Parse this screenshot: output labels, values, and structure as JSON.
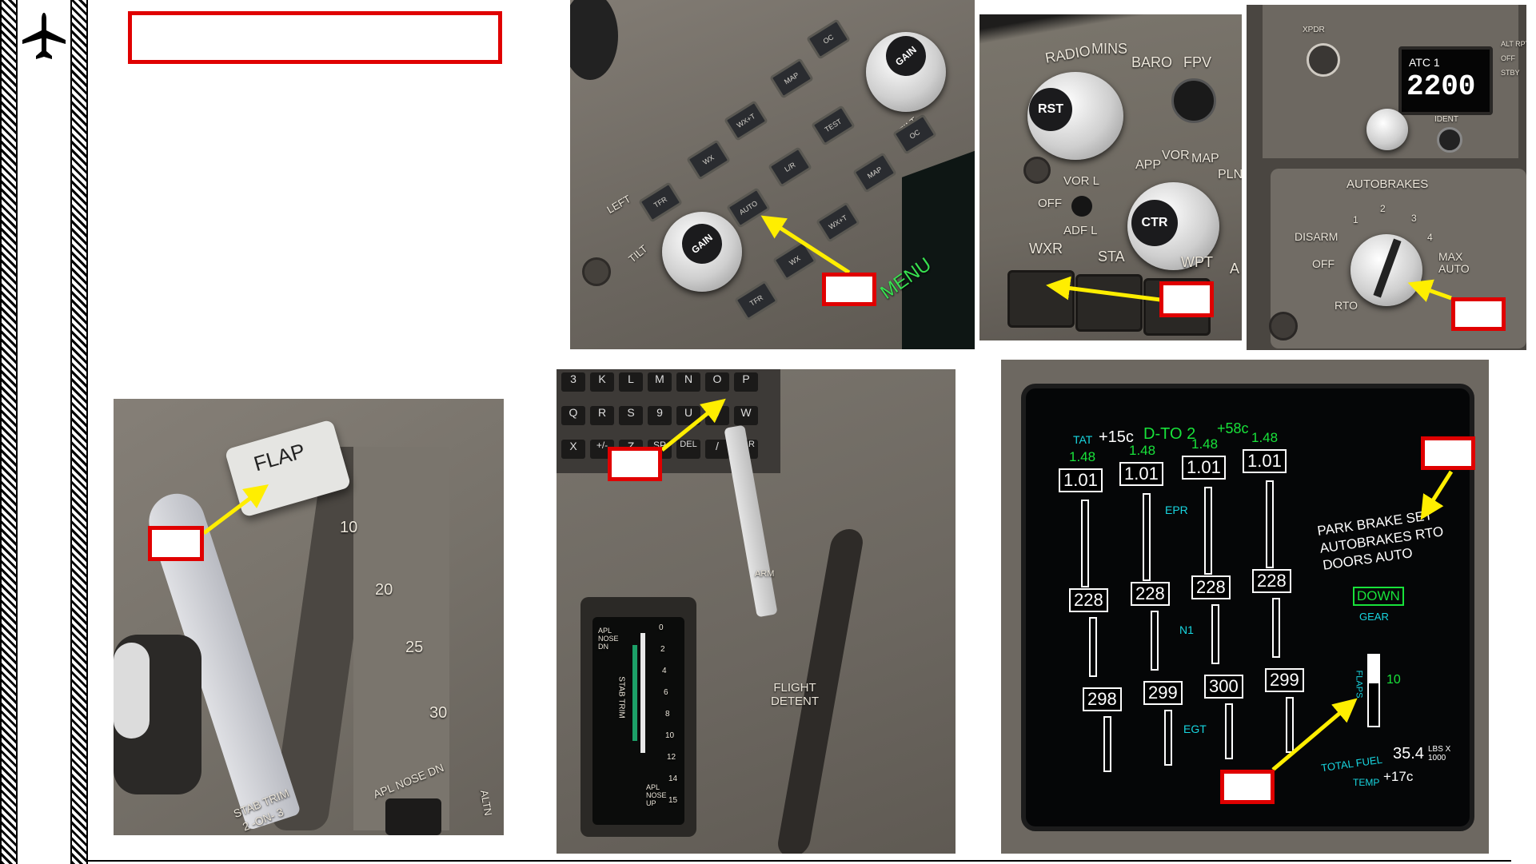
{
  "sidebar": {
    "icon": "airplane-icon"
  },
  "title_box": {
    "text": ""
  },
  "callouts": {
    "mode_button": "",
    "wxr_button": "",
    "autobrake_knob": "",
    "flap_lever": "",
    "speedbrake_lever": "",
    "eicas_status": "",
    "flaps_indicator": ""
  },
  "weather_radar": {
    "gain_label": "GAIN",
    "tilt_label": "TILT",
    "left_label": "LEFT",
    "buttons": [
      "TFR",
      "WX",
      "WX+T",
      "MAP",
      "OC",
      "AUTO",
      "L/R",
      "TEST",
      "MAP",
      "OC",
      "TFR",
      "WX",
      "WX+T",
      "GAIN"
    ],
    "menu_label": "MENU"
  },
  "efis": {
    "radio": "RADIO",
    "mins": "MINS",
    "baro": "BARO",
    "fpv": "FPV",
    "rst": "RST",
    "ctr": "CTR",
    "vor_l": "VOR L",
    "off": "OFF",
    "adf_l": "ADF L",
    "app": "APP",
    "vor": "VOR",
    "map": "MAP",
    "pln": "PLN",
    "wxr": "WXR",
    "sta": "STA",
    "wpt": "WPT",
    "arpt": "A"
  },
  "autobrakes": {
    "xpdr": "XPDR",
    "atc_label": "ATC 1",
    "atc_code": "2200",
    "ident": "IDENT",
    "title": "AUTOBRAKES",
    "positions": [
      "DISARM",
      "OFF",
      "RTO",
      "1",
      "2",
      "3",
      "4",
      "MAX AUTO"
    ],
    "side": [
      "ALT RPTG",
      "OFF",
      "STBY"
    ]
  },
  "flap_panel": {
    "handle_label": "FLAP",
    "detents": [
      "10",
      "20",
      "25",
      "30"
    ],
    "stab_trim": "STAB TRIM",
    "stab_trim_sub": "2 -ON- 3",
    "apl_nose_dn": "APL NOSE DN",
    "altn": "ALTN"
  },
  "speedbrake_panel": {
    "keys": [
      "3",
      "K",
      "L",
      "M",
      "N",
      "O",
      "P",
      "Q",
      "R",
      "S",
      "9",
      "U",
      "V",
      "W",
      "X",
      "+/-",
      "Z",
      "SP",
      "DEL",
      "/",
      "CLR"
    ],
    "arm": "ARM",
    "flight_detent": "FLIGHT DETENT",
    "stab_trim": "STAB TRIM",
    "apl_nose_dn": "APL NOSE DN",
    "apl_nose_up": "APL NOSE UP",
    "scale": [
      "0",
      "2",
      "4",
      "6",
      "8",
      "10",
      "12",
      "14",
      "15"
    ]
  },
  "eicas": {
    "tat": "TAT",
    "tat_val": "+15c",
    "mode": "D-TO 2",
    "tat2": "+58c",
    "epr_ref": [
      "1.48",
      "1.48",
      "1.48",
      "1.48"
    ],
    "epr": [
      "1.01",
      "1.01",
      "1.01",
      "1.01"
    ],
    "epr_label": "EPR",
    "n1": [
      "228",
      "228",
      "228",
      "228"
    ],
    "n1_label": "N1",
    "egt": [
      "298",
      "299",
      "300",
      "299"
    ],
    "egt_label": "EGT",
    "messages": [
      "PARK BRAKE SET",
      "AUTOBRAKES RTO",
      "DOORS AUTO"
    ],
    "gear_state": "DOWN",
    "gear_label": "GEAR",
    "flaps_label": "FLAPS",
    "flaps_val": "10",
    "fuel_label": "TOTAL FUEL",
    "fuel_val": "35.4",
    "fuel_units": "LBS X 1000",
    "temp_label": "TEMP",
    "temp_val": "+17c"
  },
  "colors": {
    "callout_red": "#e00000",
    "arrow_yellow": "#ffee00",
    "eicas_green": "#18e23a",
    "eicas_cyan": "#18d6e0",
    "panel_gray": "#6f6a63"
  }
}
